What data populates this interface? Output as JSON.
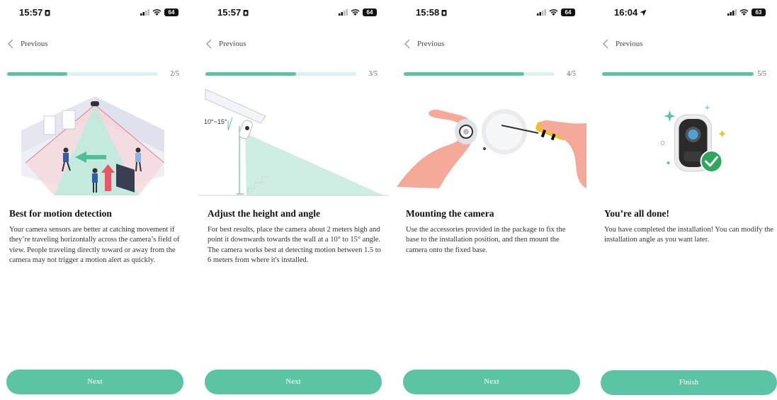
{
  "screens": [
    {
      "status": {
        "time": "15:57",
        "battery": "64"
      },
      "back_label": "Previous",
      "progress": {
        "label": "2/5",
        "fraction": 0.4
      },
      "title": "Best for motion detection",
      "description": "Your camera sensors are better at catching movement if they’re traveling horizontally across the camera’s field of view. People traveling directly toward or away from the camera may not trigger a motion alert as quickly.",
      "button_label": "Next"
    },
    {
      "status": {
        "time": "15:57",
        "battery": "64"
      },
      "back_label": "Previous",
      "progress": {
        "label": "3/5",
        "fraction": 0.6
      },
      "title": "Adjust the height and angle",
      "description": "For best results, place the camera about 2 meters high and point it downwards towards the wall at a 10° to 15° angle. The camera works best at detecting motion between 1.5 to 6 meters from where it's installed.",
      "angle_label": "10°~15°",
      "button_label": "Next"
    },
    {
      "status": {
        "time": "15:58",
        "battery": "64"
      },
      "back_label": "Previous",
      "progress": {
        "label": "4/5",
        "fraction": 0.8
      },
      "title": "Mounting the camera",
      "description": "Use the accessories provided in the package to fix the base to the installation position, and then mount the camera onto the fixed base.",
      "button_label": "Next"
    },
    {
      "status": {
        "time": "16:04",
        "battery": "63"
      },
      "back_label": "Previous",
      "progress": {
        "label": "5/5",
        "fraction": 1.0
      },
      "title": "You’re all done!",
      "description": "You have completed the installation! You can modify the installation angle as you want later.",
      "button_label": "Finish"
    }
  ],
  "colors": {
    "accent": "#5bc4a5",
    "track": "#dff1ec",
    "skin": "#f4a999",
    "warning": "#e8566a"
  },
  "icons": {
    "back": "chevron-left-icon",
    "done": "checkmark-icon",
    "time_lock": "lock-icon",
    "location": "location-arrow-icon"
  }
}
